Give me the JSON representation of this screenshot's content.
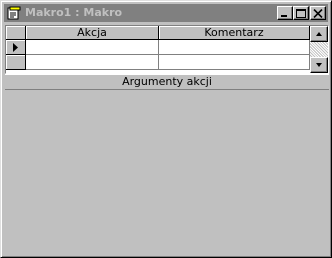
{
  "window": {
    "title": "Makro1 : Makro"
  },
  "grid": {
    "columns": [
      "Akcja",
      "Komentarz"
    ],
    "rows": [
      {
        "akcja": "",
        "komentarz": ""
      },
      {
        "akcja": "",
        "komentarz": ""
      }
    ]
  },
  "arguments": {
    "label": "Argumenty akcji"
  },
  "icons": {
    "title": "macro-icon",
    "minimize": "minimize-icon",
    "maximize": "maximize-icon",
    "close": "close-icon",
    "row_selector": "current-row-arrow-icon",
    "scroll_up": "arrow-up-icon",
    "scroll_down": "arrow-down-icon"
  }
}
